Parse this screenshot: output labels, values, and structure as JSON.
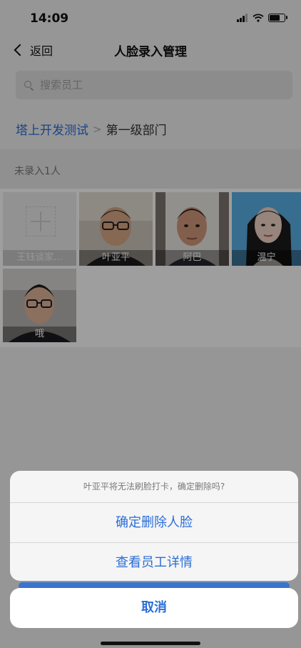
{
  "status": {
    "time": "14:09",
    "battery_level": 0.75
  },
  "nav": {
    "back_label": "返回",
    "title": "人脸录入管理"
  },
  "search": {
    "placeholder": "搜索员工"
  },
  "breadcrumb": {
    "root": "塔上开发测试",
    "separator": ">",
    "current": "第一级部门"
  },
  "section": {
    "label": "未录入1人"
  },
  "employees": [
    {
      "name": "王钰谈家...",
      "has_face": false
    },
    {
      "name": "叶亚平",
      "has_face": true
    },
    {
      "name": "阿巴",
      "has_face": true
    },
    {
      "name": "温宁",
      "has_face": true
    },
    {
      "name": "哦",
      "has_face": true
    }
  ],
  "action_sheet": {
    "message": "叶亚平将无法刷脸打卡，确定删除吗?",
    "delete_label": "确定删除人脸",
    "details_label": "查看员工详情",
    "cancel_label": "取消"
  },
  "colors": {
    "accent": "#2a6ed8",
    "background": "#f2f2f2"
  }
}
